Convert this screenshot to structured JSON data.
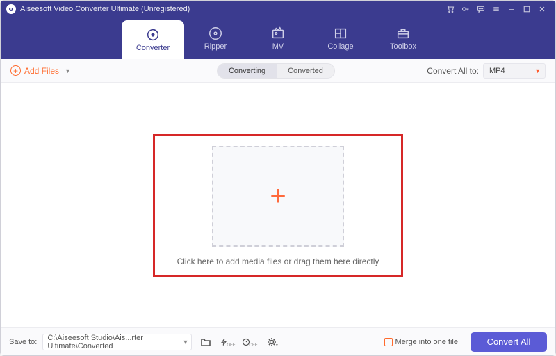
{
  "title": "Aiseesoft Video Converter Ultimate (Unregistered)",
  "tabs": {
    "converter": "Converter",
    "ripper": "Ripper",
    "mv": "MV",
    "collage": "Collage",
    "toolbox": "Toolbox"
  },
  "toolbar": {
    "add_files": "Add Files",
    "seg_converting": "Converting",
    "seg_converted": "Converted",
    "convert_all_label": "Convert All to:",
    "convert_all_value": "MP4"
  },
  "workspace": {
    "hint": "Click here to add media files or drag them here directly"
  },
  "footer": {
    "save_to_label": "Save to:",
    "save_to_path": "C:\\Aiseesoft Studio\\Ais...rter Ultimate\\Converted",
    "merge_label": "Merge into one file",
    "convert_btn": "Convert All"
  }
}
